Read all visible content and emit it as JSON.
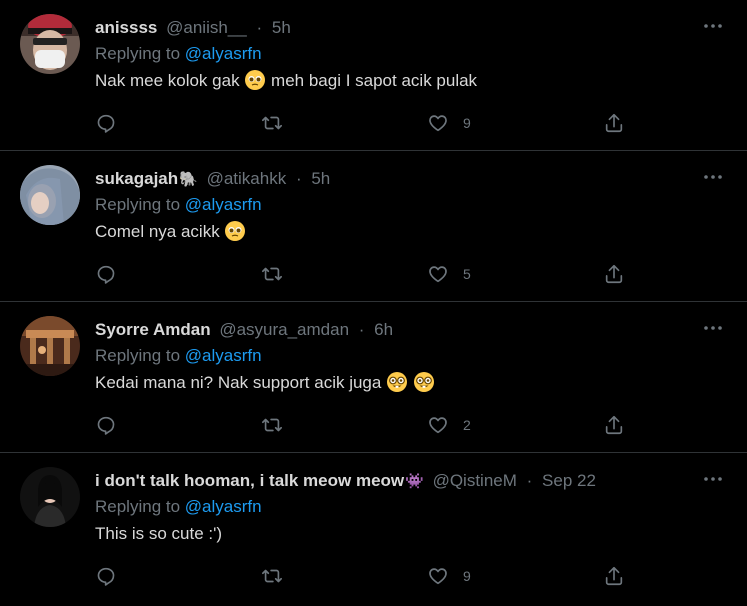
{
  "colors": {
    "background": "#000000",
    "text": "#d9d9d9",
    "muted": "#6e767d",
    "link": "#1d9bf0",
    "divider": "#2f3336"
  },
  "icons": {
    "reply": "reply-icon",
    "retweet": "retweet-icon",
    "like": "heart-icon",
    "share": "share-icon",
    "more": "more-icon"
  },
  "tweets": [
    {
      "display_name": "anissss",
      "badge": "",
      "handle": "@aniish__",
      "separator": "·",
      "time": "5h",
      "replying_prefix": "Replying to",
      "replying_to": "@alyasrfn",
      "text_parts": [
        "Nak mee kolok gak",
        "meh bagi I sapot acik pulak"
      ],
      "emoji_count": 1,
      "like_count": "9"
    },
    {
      "display_name": "sukagajah",
      "badge": "🐘",
      "handle": "@atikahkk",
      "separator": "·",
      "time": "5h",
      "replying_prefix": "Replying to",
      "replying_to": "@alyasrfn",
      "text_parts": [
        "Comel nya acikk"
      ],
      "emoji_count": 1,
      "like_count": "5"
    },
    {
      "display_name": "Syorre Amdan",
      "badge": "",
      "handle": "@asyura_amdan",
      "separator": "·",
      "time": "6h",
      "replying_prefix": "Replying to",
      "replying_to": "@alyasrfn",
      "text_parts": [
        "Kedai mana ni? Nak support acik juga"
      ],
      "emoji_count": 2,
      "like_count": "2"
    },
    {
      "display_name": "i don't talk hooman, i talk meow meow",
      "badge": "👾",
      "handle": "@QistineM",
      "separator": "·",
      "time": "Sep 22",
      "replying_prefix": "Replying to",
      "replying_to": "@alyasrfn",
      "text_parts": [
        "This is so cute :')"
      ],
      "emoji_count": 0,
      "like_count": "9"
    }
  ]
}
